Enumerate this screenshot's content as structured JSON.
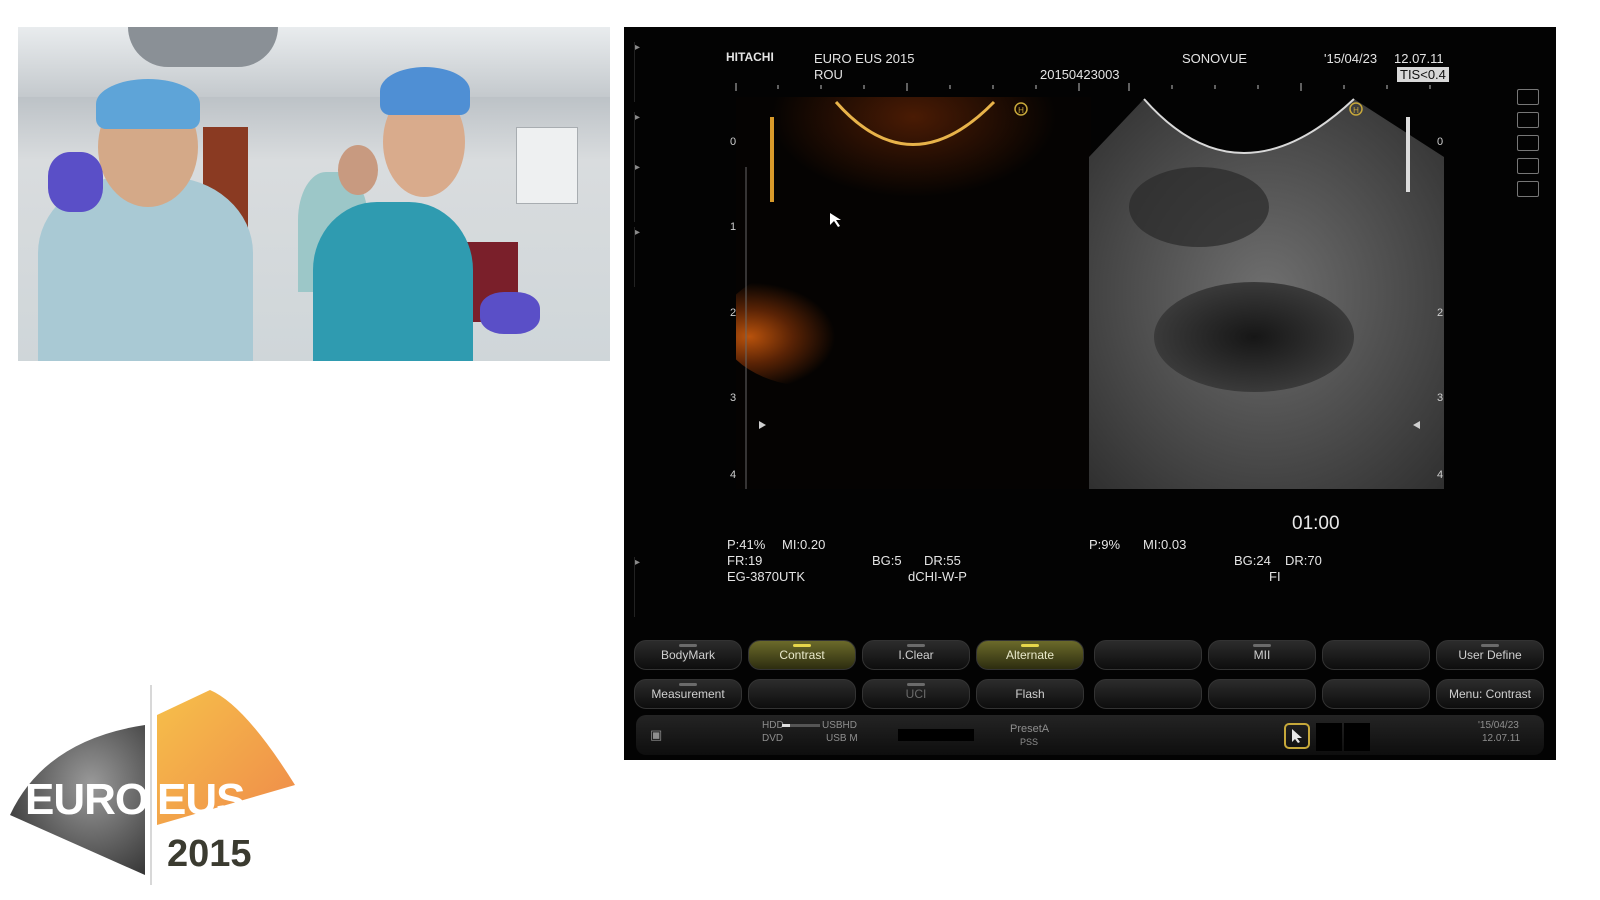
{
  "logo": {
    "left_word": "EURO",
    "right_word": "EUS",
    "year": "2015"
  },
  "ultrasound": {
    "header": {
      "brand": "HITACHI",
      "event": "EURO EUS 2015",
      "site": "ROU",
      "id": "20150423003",
      "agent": "SONOVUE",
      "date": "'15/04/23",
      "time": "12.07.11",
      "tis": "TIS<0.4"
    },
    "depth_scale": [
      "0",
      "1",
      "2",
      "3",
      "4"
    ],
    "timer": "01:00",
    "left_params": {
      "power": "P:41%",
      "mi": "MI:0.20",
      "fr": "FR:19",
      "bg": "BG:5",
      "dr": "DR:55",
      "probe": "EG-3870UTK",
      "mode": "dCHI-W-P"
    },
    "right_params": {
      "power": "P:9%",
      "mi": "MI:0.03",
      "bg": "BG:24",
      "dr": "DR:70",
      "mode": "FI"
    },
    "buttons_row1": [
      "BodyMark",
      "Contrast",
      "I.Clear",
      "Alternate",
      "",
      "MII",
      "",
      "User Define"
    ],
    "buttons_row2": [
      "Measurement",
      "",
      "UCI",
      "Flash",
      "",
      "",
      "",
      "Menu: Contrast"
    ],
    "active_buttons": [
      "Contrast",
      "Alternate"
    ],
    "status": {
      "hdd": "HDD",
      "usbhd": "USBHD",
      "dvd": "DVD",
      "usbm": "USB M",
      "preset": "PresetA",
      "preset_sub": "PSS",
      "date": "'15/04/23",
      "time": "12.07.11"
    }
  }
}
